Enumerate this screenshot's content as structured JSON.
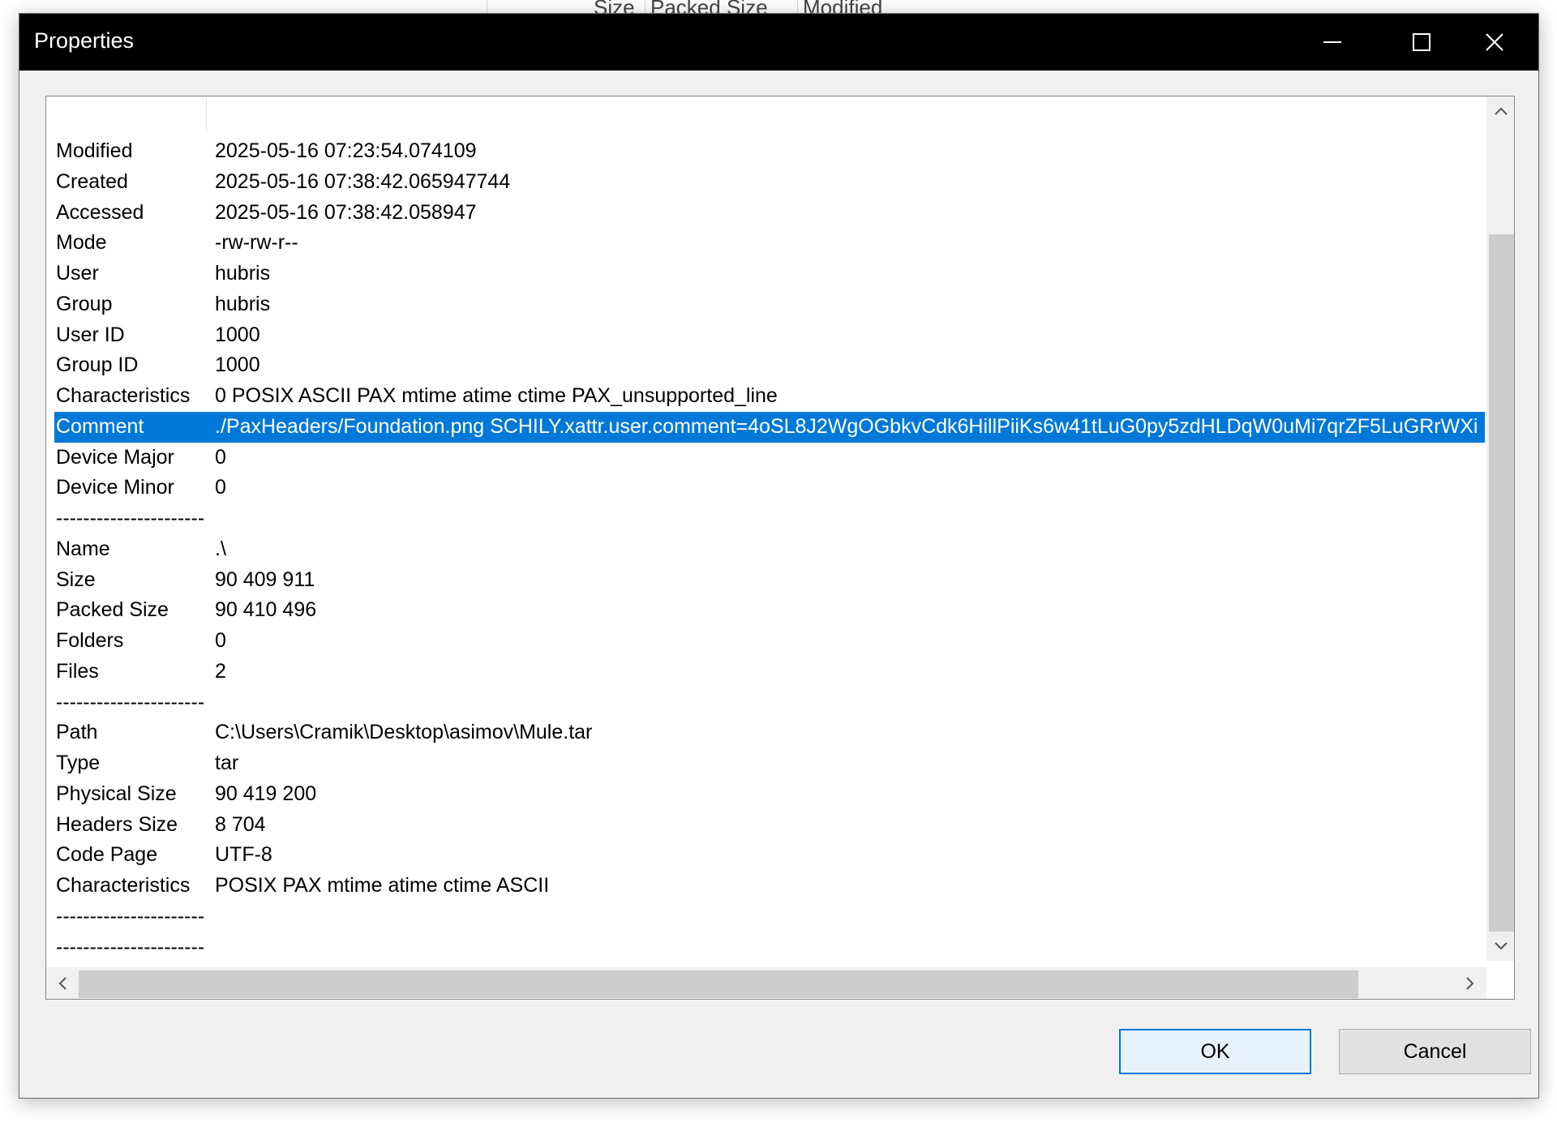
{
  "background": {
    "column_headers": [
      "Size",
      "Packed Size",
      "Modified"
    ]
  },
  "dialog": {
    "title": "Properties",
    "selected_row_color": "#0078d7"
  },
  "properties": [
    {
      "name": "Modified",
      "value": "2025-05-16 07:23:54.074109"
    },
    {
      "name": "Created",
      "value": "2025-05-16 07:38:42.065947744"
    },
    {
      "name": "Accessed",
      "value": "2025-05-16 07:38:42.058947"
    },
    {
      "name": "Mode",
      "value": "-rw-rw-r--"
    },
    {
      "name": "User",
      "value": "hubris"
    },
    {
      "name": "Group",
      "value": "hubris"
    },
    {
      "name": "User ID",
      "value": "1000"
    },
    {
      "name": "Group ID",
      "value": "1000"
    },
    {
      "name": "Characteristics",
      "value": "0 POSIX ASCII PAX mtime atime ctime PAX_unsupported_line"
    },
    {
      "name": "Comment",
      "value": "./PaxHeaders/Foundation.png SCHILY.xattr.user.comment=4oSL8J2WgOGbkvCdk6HillPiiKs6w41tLuG0py5zdHLDqW0uMi7qrZF5LuGRrWXi",
      "selected": true
    },
    {
      "name": "Device Major",
      "value": "0"
    },
    {
      "name": "Device Minor",
      "value": "0"
    },
    {
      "name": "----------------------",
      "value": ""
    },
    {
      "name": "Name",
      "value": ".\\"
    },
    {
      "name": "Size",
      "value": "90 409 911"
    },
    {
      "name": "Packed Size",
      "value": "90 410 496"
    },
    {
      "name": "Folders",
      "value": "0"
    },
    {
      "name": "Files",
      "value": "2"
    },
    {
      "name": "----------------------",
      "value": ""
    },
    {
      "name": "Path",
      "value": "C:\\Users\\Cramik\\Desktop\\asimov\\Mule.tar"
    },
    {
      "name": "Type",
      "value": "tar"
    },
    {
      "name": "Physical Size",
      "value": "90 419 200"
    },
    {
      "name": "Headers Size",
      "value": "8 704"
    },
    {
      "name": "Code Page",
      "value": "UTF-8"
    },
    {
      "name": "Characteristics",
      "value": "POSIX PAX mtime atime ctime ASCII"
    },
    {
      "name": "----------------------",
      "value": ""
    },
    {
      "name": "----------------------",
      "value": ""
    }
  ],
  "buttons": {
    "ok_label": "OK",
    "cancel_label": "Cancel"
  },
  "icons": {
    "minimize": "minimize-icon",
    "maximize": "maximize-icon",
    "close": "close-icon",
    "scroll_up": "chevron-up-icon",
    "scroll_down": "chevron-down-icon",
    "scroll_left": "chevron-left-icon",
    "scroll_right": "chevron-right-icon"
  }
}
